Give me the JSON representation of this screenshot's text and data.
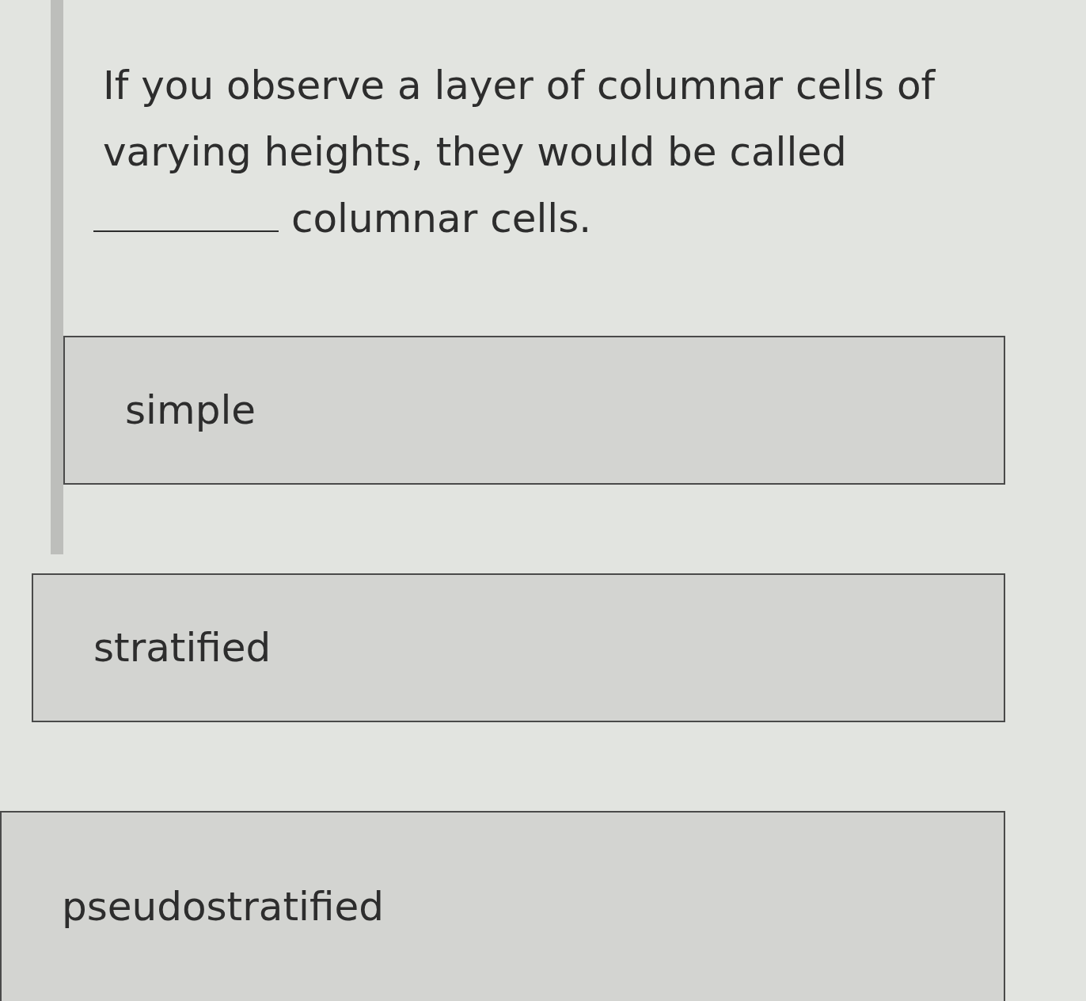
{
  "question": {
    "text_before_blank": "If you observe a layer of columnar cells of varying heights, they would be called",
    "text_after_blank": "columnar cells."
  },
  "options": [
    {
      "label": "simple",
      "selected": false
    },
    {
      "label": "stratified",
      "selected": false
    },
    {
      "label": "pseudostratified",
      "selected": false
    }
  ]
}
